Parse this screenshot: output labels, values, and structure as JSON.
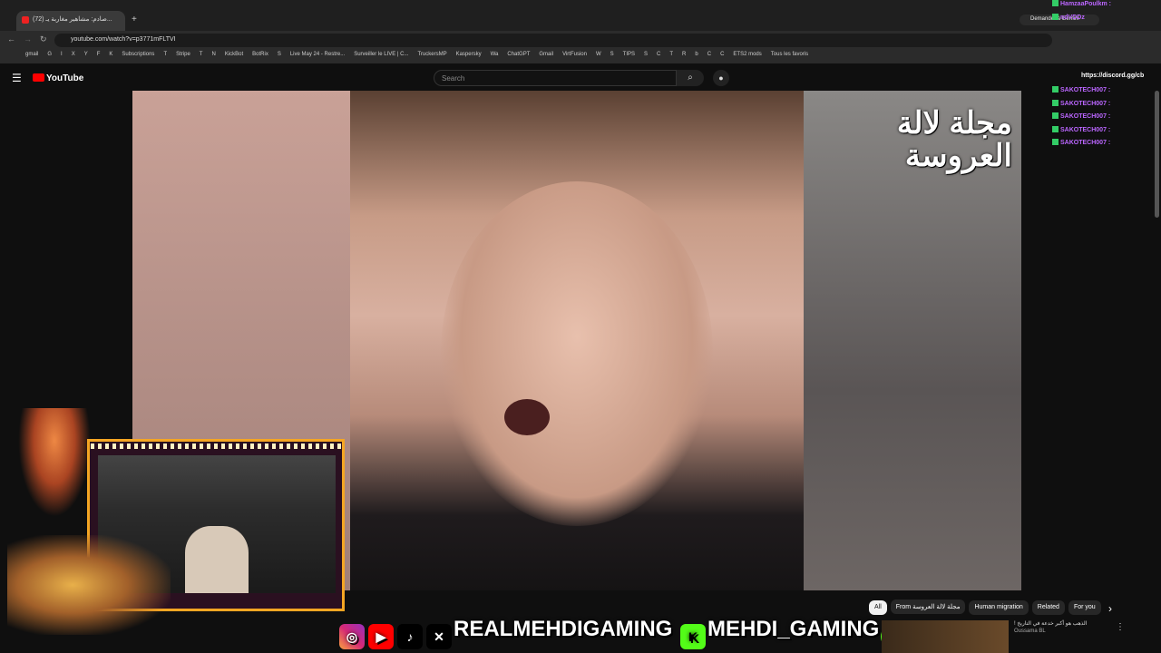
{
  "browser": {
    "tab_title": "(72) صادم: مشاهير مغاربة يـ...",
    "url": "youtube.com/watch?v=p3771mFLTVI",
    "gemini_button": "Demander à Gemini",
    "bookmarks": [
      "gmail",
      "G",
      "I",
      "X",
      "Y",
      "F",
      "K",
      "Subscriptions",
      "T",
      "Stripe",
      "T",
      "N",
      "KickBot",
      "BotRix",
      "S",
      "Live May 24 - Restre...",
      "Surveiller le LIVE | C...",
      "TruckersMP",
      "Kaspersky",
      "Wa",
      "ChatGPT",
      "Gmail",
      "VirtFusion",
      "W",
      "S",
      "TIPS",
      "S",
      "C",
      "T",
      "R",
      "b",
      "C",
      "C",
      "ETS2 mods",
      "Tous les favoris"
    ]
  },
  "youtube": {
    "logo_text": "YouTube",
    "search_placeholder": "Search",
    "search_icon": "search-icon",
    "mic_icon": "mic-icon"
  },
  "video": {
    "watermark": "مجلة لالة العروسة"
  },
  "chat": {
    "messages": [
      "HamzaaPoulkm :",
      "ndVDDz",
      "SAKOTECH007 :",
      "SAKOTECH007 :",
      "SAKOTECH007 :",
      "SAKOTECH007 :",
      "SAKOTECH007 :"
    ],
    "link": "https://discord.gg/cb"
  },
  "chips": [
    "All",
    "From مجلة لالة العروسة",
    "Human migration",
    "Related",
    "For you"
  ],
  "banner": {
    "text1": "REALMEHDIGAMING",
    "text2": "MEHDI_GAMING"
  },
  "side_video": {
    "title": "الذهب هو أكبر خدعة في التاريخ !",
    "channel": "Oussama BL"
  },
  "colors": {
    "youtube_red": "#ff0000",
    "overlay_gold": "#f5a623",
    "chat_purple": "#bb66ff",
    "kick_green": "#53fc18"
  }
}
